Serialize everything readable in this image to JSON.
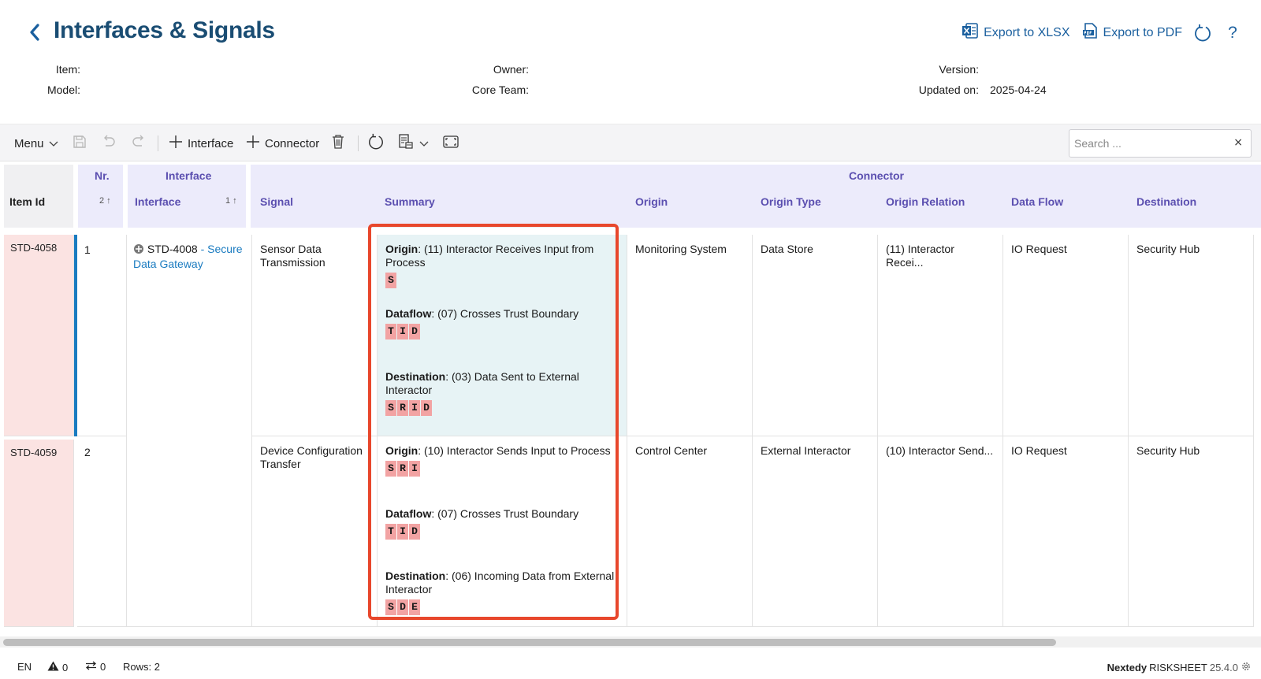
{
  "header": {
    "title": "Interfaces & Signals",
    "export_xlsx": "Export to XLSX",
    "export_pdf": "Export to PDF",
    "help": "?"
  },
  "meta": {
    "item_label": "Item:",
    "model_label": "Model:",
    "owner_label": "Owner:",
    "core_team_label": "Core Team:",
    "version_label": "Version:",
    "updated_label": "Updated on:",
    "updated_value": "2025-04-24"
  },
  "toolbar": {
    "menu": "Menu",
    "add_interface": "Interface",
    "add_connector": "Connector",
    "search_placeholder": "Search ...",
    "clear": "×"
  },
  "columns": {
    "item_id": "Item Id",
    "nr_group": "Nr.",
    "nr_sort": "2",
    "interface_group": "Interface",
    "interface": "Interface",
    "interface_sort": "1",
    "connector_group": "Connector",
    "signal": "Signal",
    "summary": "Summary",
    "origin": "Origin",
    "origin_type": "Origin Type",
    "origin_relation": "Origin Relation",
    "data_flow": "Data Flow",
    "destination": "Destination"
  },
  "rows": [
    {
      "item_id": "STD-4058",
      "nr": "1",
      "interface_id": "STD-4008",
      "interface_sep": " - ",
      "interface_name": "Secure Data Gateway",
      "signal": "Sensor Data Transmission",
      "summary": [
        {
          "label": "Origin",
          "text": ": (11) Interactor Receives Input from Process",
          "tags": [
            "S"
          ]
        },
        {
          "label": "Dataflow",
          "text": ": (07) Crosses Trust Boundary",
          "tags": [
            "T",
            "I",
            "D"
          ]
        },
        {
          "label": "Destination",
          "text": ": (03) Data Sent to External Interactor",
          "tags": [
            "S",
            "R",
            "I",
            "D"
          ]
        }
      ],
      "origin": "Monitoring System",
      "origin_type": "Data Store",
      "origin_relation": "(11) Interactor Recei...",
      "data_flow": "IO Request",
      "destination": "Security Hub"
    },
    {
      "item_id": "STD-4059",
      "nr": "2",
      "signal": "Device Configuration Transfer",
      "summary": [
        {
          "label": "Origin",
          "text": ": (10) Interactor Sends Input to Process",
          "tags": [
            "S",
            "R",
            "I"
          ]
        },
        {
          "label": "Dataflow",
          "text": ": (07) Crosses Trust Boundary",
          "tags": [
            "T",
            "I",
            "D"
          ]
        },
        {
          "label": "Destination",
          "text": ": (06) Incoming Data from External Interactor",
          "tags": [
            "S",
            "D",
            "E"
          ]
        }
      ],
      "origin": "Control Center",
      "origin_type": "External Interactor",
      "origin_relation": "(10) Interactor Send...",
      "data_flow": "IO Request",
      "destination": "Security Hub"
    }
  ],
  "status": {
    "lang": "EN",
    "warnings": "0",
    "links": "0",
    "rows": "Rows: 2",
    "brand": "Nextedy",
    "product": "RISKSHEET",
    "version": "25.4.0"
  }
}
